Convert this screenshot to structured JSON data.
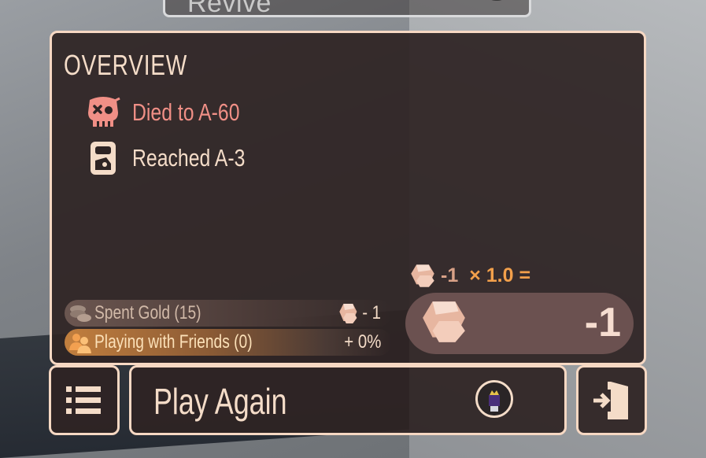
{
  "revive": {
    "label": "Revive"
  },
  "overview": {
    "title": "OVERVIEW",
    "death": {
      "text": "Died to A-60",
      "icon": "skull-icon"
    },
    "reached": {
      "text": "Reached A-3",
      "icon": "door-card-icon"
    }
  },
  "bonuses": {
    "spent_gold": {
      "label": "Spent Gold (15)",
      "value": "- 1",
      "icon": "coins-icon"
    },
    "friends": {
      "label": "Playing with Friends (0)",
      "value": "+ 0%",
      "icon": "friends-icon"
    }
  },
  "formula": {
    "amount": "-1",
    "multiplier": "× 1.0 ="
  },
  "total": {
    "value": "-1"
  },
  "buttons": {
    "play_again": "Play Again"
  },
  "colors": {
    "accent": "#f6d8c3",
    "death_text": "#f08f86",
    "multiplier": "#f3a04b"
  }
}
